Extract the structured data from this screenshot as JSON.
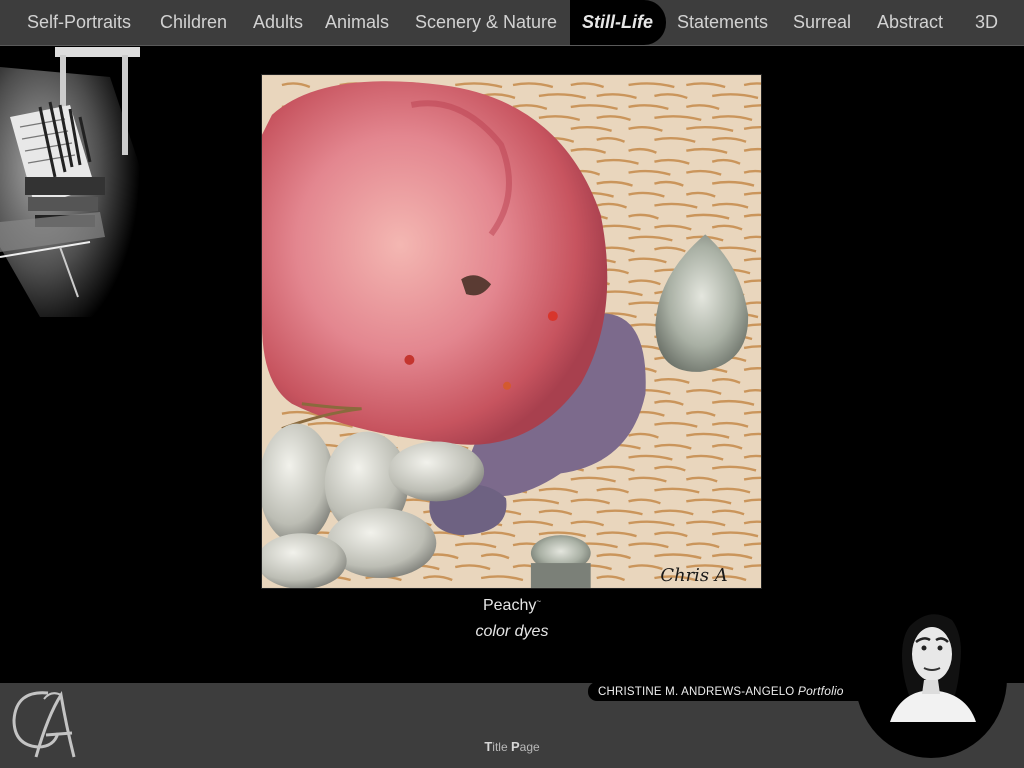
{
  "nav": {
    "items": [
      {
        "label": "Self-Portraits",
        "active": false
      },
      {
        "label": "Children",
        "active": false
      },
      {
        "label": "Adults",
        "active": false
      },
      {
        "label": "Animals",
        "active": false
      },
      {
        "label": "Scenery & Nature",
        "active": false
      },
      {
        "label": "Still-Life",
        "active": true
      },
      {
        "label": "Statements",
        "active": false
      },
      {
        "label": "Surreal",
        "active": false
      },
      {
        "label": "Abstract",
        "active": false
      },
      {
        "label": "3D",
        "active": false
      }
    ]
  },
  "artwork": {
    "title": "Peachy",
    "title_mark": "~",
    "medium": "color dyes",
    "signature": "Chris A"
  },
  "footer": {
    "title_page_first": "T",
    "title_page_mid": "itle ",
    "title_page_p": "P",
    "title_page_rest": "age",
    "artist_name": "CHRISTINE M. ANDREWS-ANGELO",
    "artist_suffix": "Portfolio",
    "logo_text": "CA"
  },
  "colors": {
    "nav_bg": "#3d3d3d",
    "page_bg": "#000000",
    "text": "#d2d2d2"
  }
}
